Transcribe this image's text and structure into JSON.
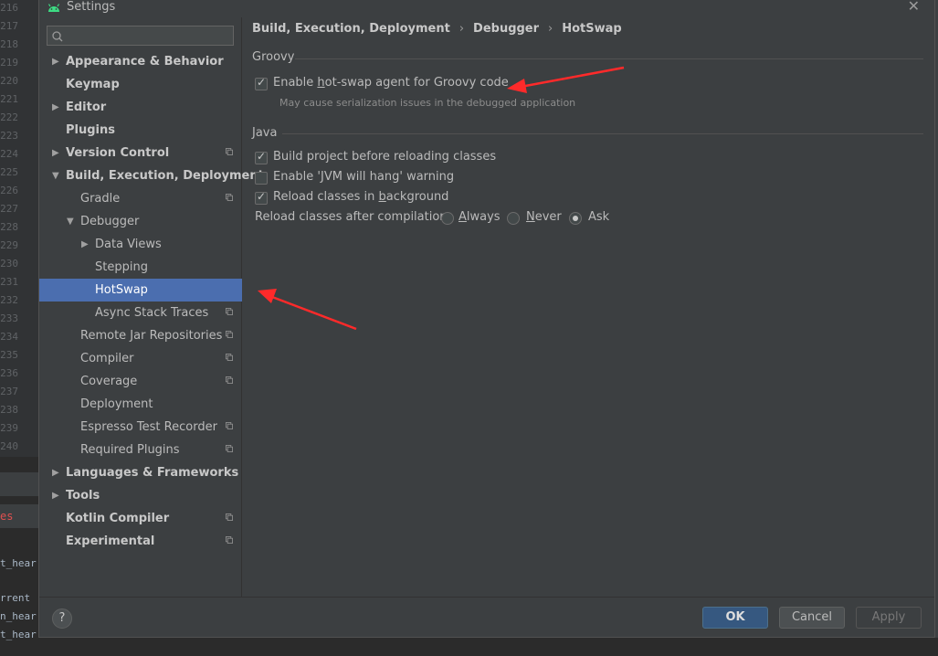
{
  "window": {
    "title": "Settings"
  },
  "gutter_lines": [
    "216",
    "217",
    "218",
    "219",
    "220",
    "221",
    "222",
    "223",
    "224",
    "225",
    "226",
    "227",
    "228",
    "229",
    "230",
    "231",
    "232",
    "233",
    "234",
    "235",
    "236",
    "237",
    "238",
    "239",
    "240"
  ],
  "background": {
    "tab_text": "es",
    "console_lines": [
      "t_hear",
      "rrent",
      "n_hear",
      "t_hear"
    ]
  },
  "search": {
    "placeholder": "",
    "value": ""
  },
  "tree": [
    {
      "label": "Appearance & Behavior",
      "level": 0,
      "arrow": "▶",
      "bold": true,
      "icon": false
    },
    {
      "label": "Keymap",
      "level": 0,
      "arrow": "",
      "bold": true,
      "icon": false
    },
    {
      "label": "Editor",
      "level": 0,
      "arrow": "▶",
      "bold": true,
      "icon": false
    },
    {
      "label": "Plugins",
      "level": 0,
      "arrow": "",
      "bold": true,
      "icon": false
    },
    {
      "label": "Version Control",
      "level": 0,
      "arrow": "▶",
      "bold": true,
      "icon": true
    },
    {
      "label": "Build, Execution, Deployment",
      "level": 0,
      "arrow": "▼",
      "bold": true,
      "icon": false
    },
    {
      "label": "Gradle",
      "level": 1,
      "arrow": "",
      "bold": false,
      "icon": true
    },
    {
      "label": "Debugger",
      "level": 1,
      "arrow": "▼",
      "bold": false,
      "icon": false
    },
    {
      "label": "Data Views",
      "level": 2,
      "arrow": "▶",
      "bold": false,
      "icon": false
    },
    {
      "label": "Stepping",
      "level": 2,
      "arrow": "",
      "bold": false,
      "icon": false
    },
    {
      "label": "HotSwap",
      "level": 2,
      "arrow": "",
      "bold": false,
      "icon": false,
      "selected": true
    },
    {
      "label": "Async Stack Traces",
      "level": 2,
      "arrow": "",
      "bold": false,
      "icon": true
    },
    {
      "label": "Remote Jar Repositories",
      "level": 1,
      "arrow": "",
      "bold": false,
      "icon": true
    },
    {
      "label": "Compiler",
      "level": 1,
      "arrow": "",
      "bold": false,
      "icon": true
    },
    {
      "label": "Coverage",
      "level": 1,
      "arrow": "",
      "bold": false,
      "icon": true
    },
    {
      "label": "Deployment",
      "level": 1,
      "arrow": "",
      "bold": false,
      "icon": false
    },
    {
      "label": "Espresso Test Recorder",
      "level": 1,
      "arrow": "",
      "bold": false,
      "icon": true
    },
    {
      "label": "Required Plugins",
      "level": 1,
      "arrow": "",
      "bold": false,
      "icon": true
    },
    {
      "label": "Languages & Frameworks",
      "level": 0,
      "arrow": "▶",
      "bold": true,
      "icon": false
    },
    {
      "label": "Tools",
      "level": 0,
      "arrow": "▶",
      "bold": true,
      "icon": false
    },
    {
      "label": "Kotlin Compiler",
      "level": 0,
      "arrow": "",
      "bold": true,
      "icon": true
    },
    {
      "label": "Experimental",
      "level": 0,
      "arrow": "",
      "bold": true,
      "icon": true
    }
  ],
  "breadcrumb": [
    "Build, Execution, Deployment",
    "Debugger",
    "HotSwap"
  ],
  "breadcrumb_separator": "›",
  "groovy": {
    "title": "Groovy",
    "enable_agent": {
      "label_pre": "Enable ",
      "label_mn": "h",
      "label_post": "ot-swap agent for Groovy code",
      "checked": true
    },
    "note": "May cause serialization issues in the debugged application"
  },
  "java": {
    "title": "Java",
    "build_before_reload": {
      "label": "Build project before reloading classes",
      "checked": true
    },
    "jvm_hang_warning": {
      "label": "Enable 'JVM will hang' warning",
      "checked": false
    },
    "reload_background": {
      "label_pre": "Reload classes in ",
      "label_mn": "b",
      "label_post": "ackground",
      "checked": true
    },
    "reload_after_compilation": {
      "label": "Reload classes after compilation:",
      "options": [
        {
          "mn": "A",
          "rest": "lways",
          "selected": false
        },
        {
          "mn": "N",
          "rest": "ever",
          "selected": false
        },
        {
          "mn": "",
          "rest": "Ask",
          "selected": true
        }
      ]
    }
  },
  "footer": {
    "help": "?",
    "ok": "OK",
    "cancel": "Cancel",
    "apply": "Apply"
  },
  "colors": {
    "selection": "#4b6eaf",
    "ok_button": "#365880",
    "annotation_arrow": "#ff2a2a",
    "android_green": "#3ddc84"
  }
}
